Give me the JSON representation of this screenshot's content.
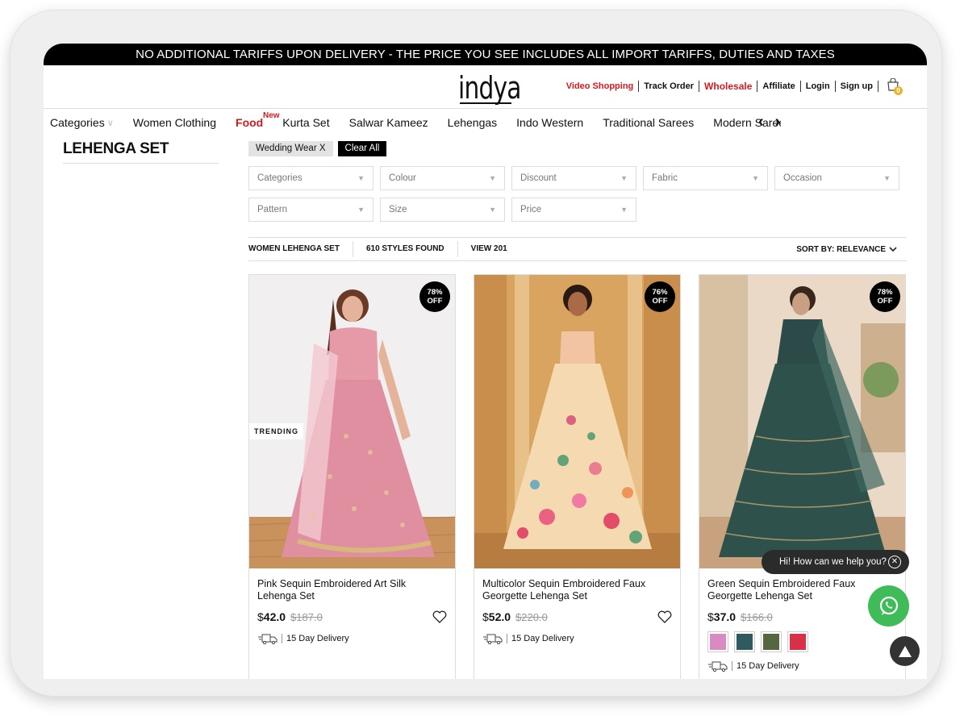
{
  "banner": "NO ADDITIONAL TARIFFS UPON DELIVERY - THE PRICE YOU SEE INCLUDES ALL IMPORT TARIFFS, DUTIES AND TAXES",
  "header": {
    "logo": "indya",
    "links": {
      "video_shopping": "Video Shopping",
      "track_order": "Track Order",
      "wholesale": "Wholesale",
      "affiliate": "Affiliate",
      "login": "Login",
      "signup": "Sign up"
    },
    "bag_count": "0"
  },
  "nav": {
    "categories": "Categories",
    "items": [
      "Women Clothing",
      "Food",
      "Kurta Set",
      "Salwar Kameez",
      "Lehengas",
      "Indo Western",
      "Traditional Sarees",
      "Modern Sarees"
    ],
    "food_badge": "New"
  },
  "sidebar": {
    "title": "LEHENGA SET"
  },
  "chips": {
    "active": "Wedding Wear X",
    "clear": "Clear All"
  },
  "filters": {
    "row1": [
      "Categories",
      "Colour",
      "Discount",
      "Fabric",
      "Occasion"
    ],
    "row2": [
      "Pattern",
      "Size",
      "Price"
    ]
  },
  "results": {
    "category": "WOMEN LEHENGA SET",
    "count": "610 STYLES FOUND",
    "view": "VIEW 201",
    "sort": "SORT BY: RELEVANCE"
  },
  "products": [
    {
      "name": "Pink Sequin Embroidered Art Silk Lehenga Set",
      "currency": "$",
      "price": "42.0",
      "old_price": "$187.0",
      "discount": "78%",
      "off": "OFF",
      "tag": "TRENDING",
      "delivery": "15 Day Delivery"
    },
    {
      "name": "Multicolor Sequin Embroidered Faux Georgette Lehenga Set",
      "currency": "$",
      "price": "52.0",
      "old_price": "$220.0",
      "discount": "76%",
      "off": "OFF",
      "delivery": "15 Day Delivery"
    },
    {
      "name": "Green Sequin Embroidered Faux Georgette Lehenga Set",
      "currency": "$",
      "price": "37.0",
      "old_price": "$166.0",
      "discount": "78%",
      "off": "OFF",
      "delivery": "15 Day Delivery",
      "swatches": [
        "#d98ac0",
        "#2f5a60",
        "#55673f",
        "#d9304a"
      ]
    }
  ],
  "chat": {
    "prompt": "Hi! How can we help you?"
  },
  "colors": {
    "accent_red": "#d7191f",
    "whatsapp_green": "#3fbb58"
  }
}
